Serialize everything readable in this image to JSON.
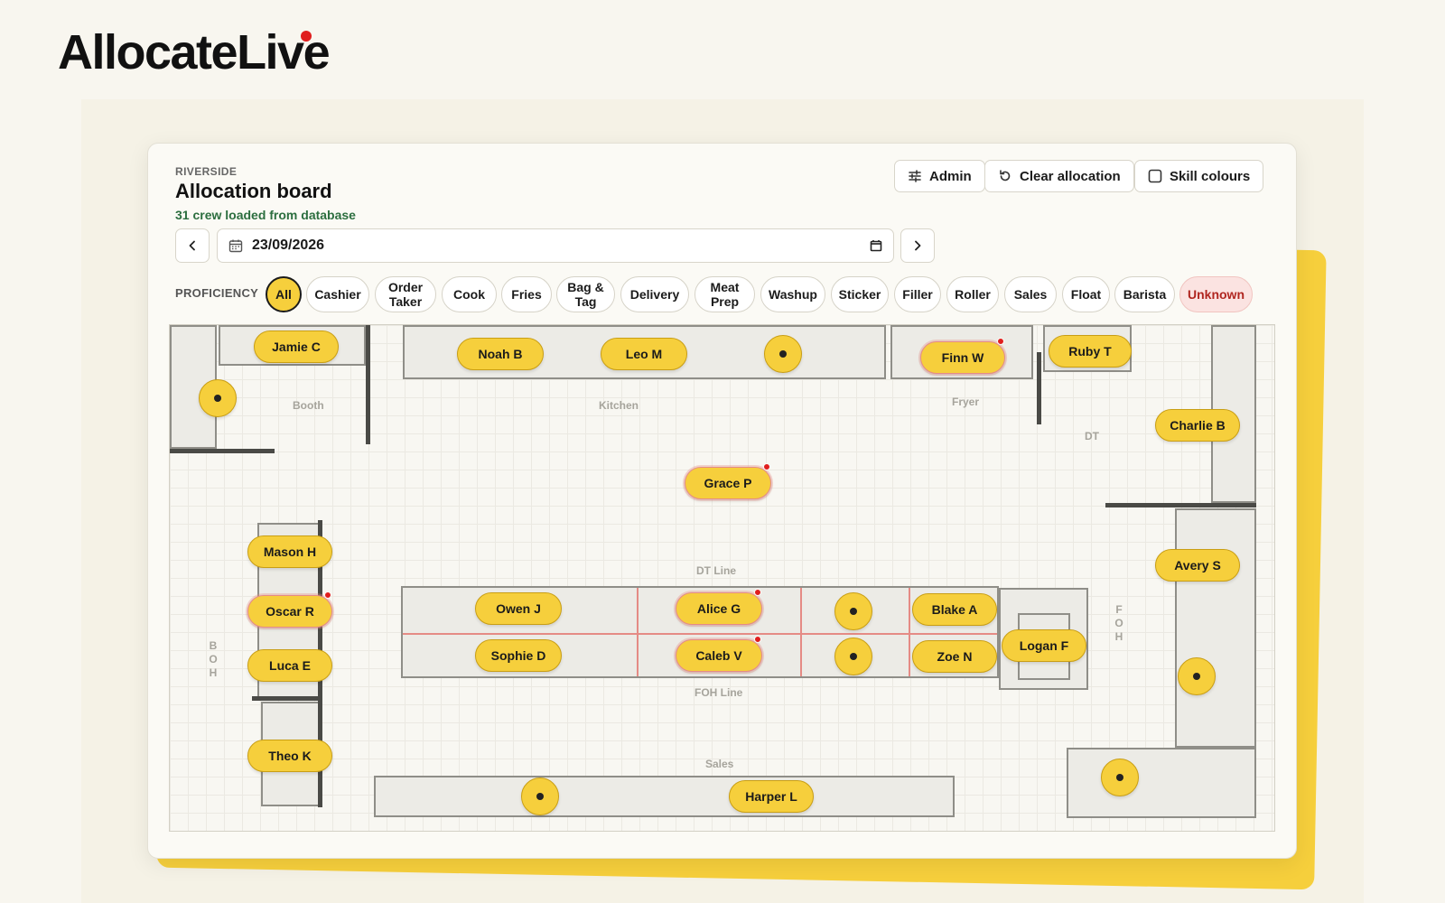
{
  "brand": {
    "name": "AllocateLive"
  },
  "header": {
    "eyebrow": "RIVERSIDE",
    "title": "Allocation board",
    "subtitle": "31 crew loaded from database"
  },
  "toolbar": {
    "admin_label": "Admin",
    "clear_label": "Clear allocation",
    "skill_colours_label": "Skill colours",
    "skill_colours_checked": false
  },
  "date": {
    "value": "23/09/2026"
  },
  "proficiency": {
    "label": "PROFICIENCY",
    "selected": "All",
    "options": [
      "All",
      "Cashier",
      "Order Taker",
      "Cook",
      "Fries",
      "Bag & Tag",
      "Delivery",
      "Meat Prep",
      "Washup",
      "Sticker",
      "Filler",
      "Roller",
      "Sales",
      "Float",
      "Barista",
      "Unknown"
    ]
  },
  "zones": {
    "booth": "Booth",
    "kitchen": "Kitchen",
    "fryer": "Fryer",
    "dt": "DT",
    "dt_line": "DT Line",
    "foh_line": "FOH Line",
    "sales": "Sales",
    "boh": "BOH",
    "foh": "FOH"
  },
  "crew": {
    "jamie": "Jamie C",
    "noah": "Noah B",
    "leo": "Leo M",
    "finn": "Finn W",
    "ruby": "Ruby T",
    "charlie": "Charlie B",
    "grace": "Grace P",
    "mason": "Mason H",
    "oscar": "Oscar R",
    "luca": "Luca E",
    "theo": "Theo K",
    "owen": "Owen J",
    "alice": "Alice G",
    "blake": "Blake A",
    "sophie": "Sophie D",
    "caleb": "Caleb V",
    "zoe": "Zoe N",
    "logan": "Logan F",
    "avery": "Avery S",
    "harper": "Harper L"
  },
  "colors": {
    "accent": "#f6cf3c",
    "alert": "#e01e1e",
    "success": "#2c6e3f",
    "unknown": "#b02620"
  }
}
